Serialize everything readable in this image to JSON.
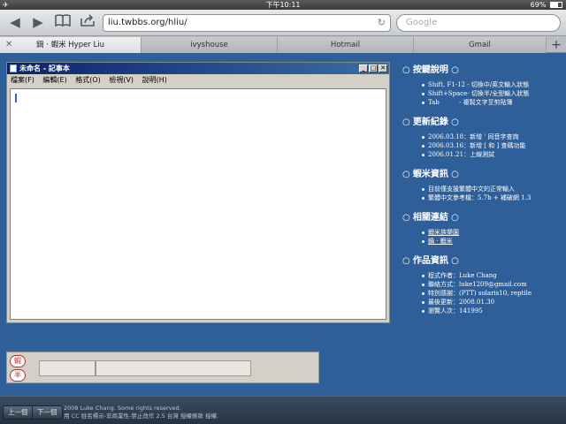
{
  "statusbar": {
    "time": "下午10:11",
    "battery": "69%",
    "battery_level": 0.69
  },
  "browser": {
    "url": "liu.twbbs.org/hliu/",
    "search_placeholder": "Google",
    "tabs": [
      {
        "label": "鍋 · 蝦米 Hyper Liu",
        "active": true
      },
      {
        "label": "ivyshouse",
        "active": false
      },
      {
        "label": "Hotmail",
        "active": false
      },
      {
        "label": "Gmail",
        "active": false
      }
    ]
  },
  "notepad": {
    "title": "未命名 - 記事本",
    "menu": [
      "檔案(F)",
      "編輯(E)",
      "格式(O)",
      "檢視(V)",
      "說明(H)"
    ]
  },
  "inputbar": {
    "mode_top": "蝦",
    "mode_bottom": "半"
  },
  "sidebar": {
    "sections": [
      {
        "title": "按鍵說明",
        "items": [
          "Shift, F1-12 - 切換中/英文輸入狀態",
          "Shift+Space- 切換半/全型輸入狀態",
          "Tab          - 複製文字至剪貼簿"
        ]
      },
      {
        "title": "更新紀錄",
        "items": [
          "2006.03.18：新增 ' 同音字查詢",
          "2006.03.16：新增 [ 和 ] 查碼功能",
          "2006.01.21：上線測試"
        ]
      },
      {
        "title": "蝦米資訊",
        "items": [
          "目前僅支援繁體中文的正常輸入",
          "繁體中文參考檔：5.7b + 補破網 1.3"
        ]
      },
      {
        "title": "相關連結",
        "links": [
          "蝦米族樂園",
          "鍋 · 蝦米"
        ]
      },
      {
        "title": "作品資訊",
        "items": [
          "程式作者：Luke Chang",
          "聯絡方式：luke1209@gmail.com",
          "特別感謝：(PTT) solaris10, reptile",
          "最後更新：2008.01.30",
          "瀏覽人次：141995"
        ]
      }
    ]
  },
  "footer": {
    "prev": "上一個",
    "next": "下一個",
    "copy_prefix": "2008",
    "copy_author": "Luke Chang",
    "copy_suffix": ". Some rights reserved.",
    "license": "用 CC 姓名標示-非商業性-禁止改作 2.5 台灣 授權條款 授權."
  }
}
